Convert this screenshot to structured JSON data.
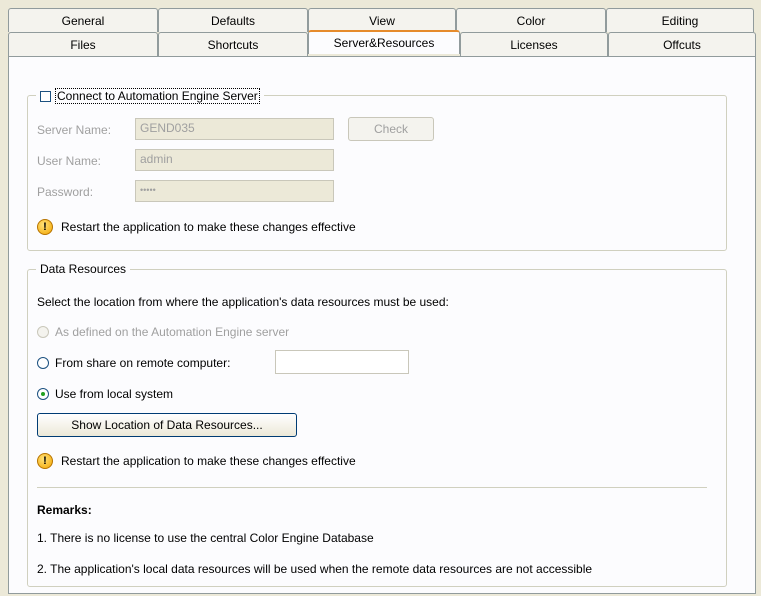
{
  "tabs": {
    "row1": [
      "General",
      "Defaults",
      "View",
      "Color",
      "Editing"
    ],
    "row2": [
      "Files",
      "Shortcuts",
      "Server&Resources",
      "Licenses",
      "Offcuts"
    ],
    "active": "Server&Resources"
  },
  "server": {
    "checkbox_label": "Connect to Automation Engine Server",
    "checked": false,
    "server_name_label": "Server Name:",
    "server_name_value": "GEND035",
    "check_button": "Check",
    "user_name_label": "User Name:",
    "user_name_value": "admin",
    "password_label": "Password:",
    "password_value": "•••••",
    "warning": "Restart the application to make these changes effective"
  },
  "resources": {
    "title": "Data Resources",
    "intro": "Select the location from where the application's data resources must be used:",
    "options": [
      {
        "label": "As defined on the Automation Engine server",
        "enabled": false,
        "selected": false
      },
      {
        "label": "From share on remote computer:",
        "enabled": true,
        "selected": false
      },
      {
        "label": "Use from local system",
        "enabled": true,
        "selected": true
      }
    ],
    "share_value": "",
    "show_button": "Show Location of Data Resources...",
    "warning": "Restart the application to make these changes effective",
    "remarks_title": "Remarks:",
    "remarks": [
      "1.  There is no license to use the central Color Engine Database",
      "2.  The application's local data resources will be used when the remote data resources are not accessible"
    ]
  },
  "colors": {
    "window_bg": "#ece9d8",
    "panel_bg": "#fcfcfe",
    "active_tab_accent": "#e68b2c",
    "warning_icon": "#f3a500",
    "selected_radio": "#21a121"
  }
}
